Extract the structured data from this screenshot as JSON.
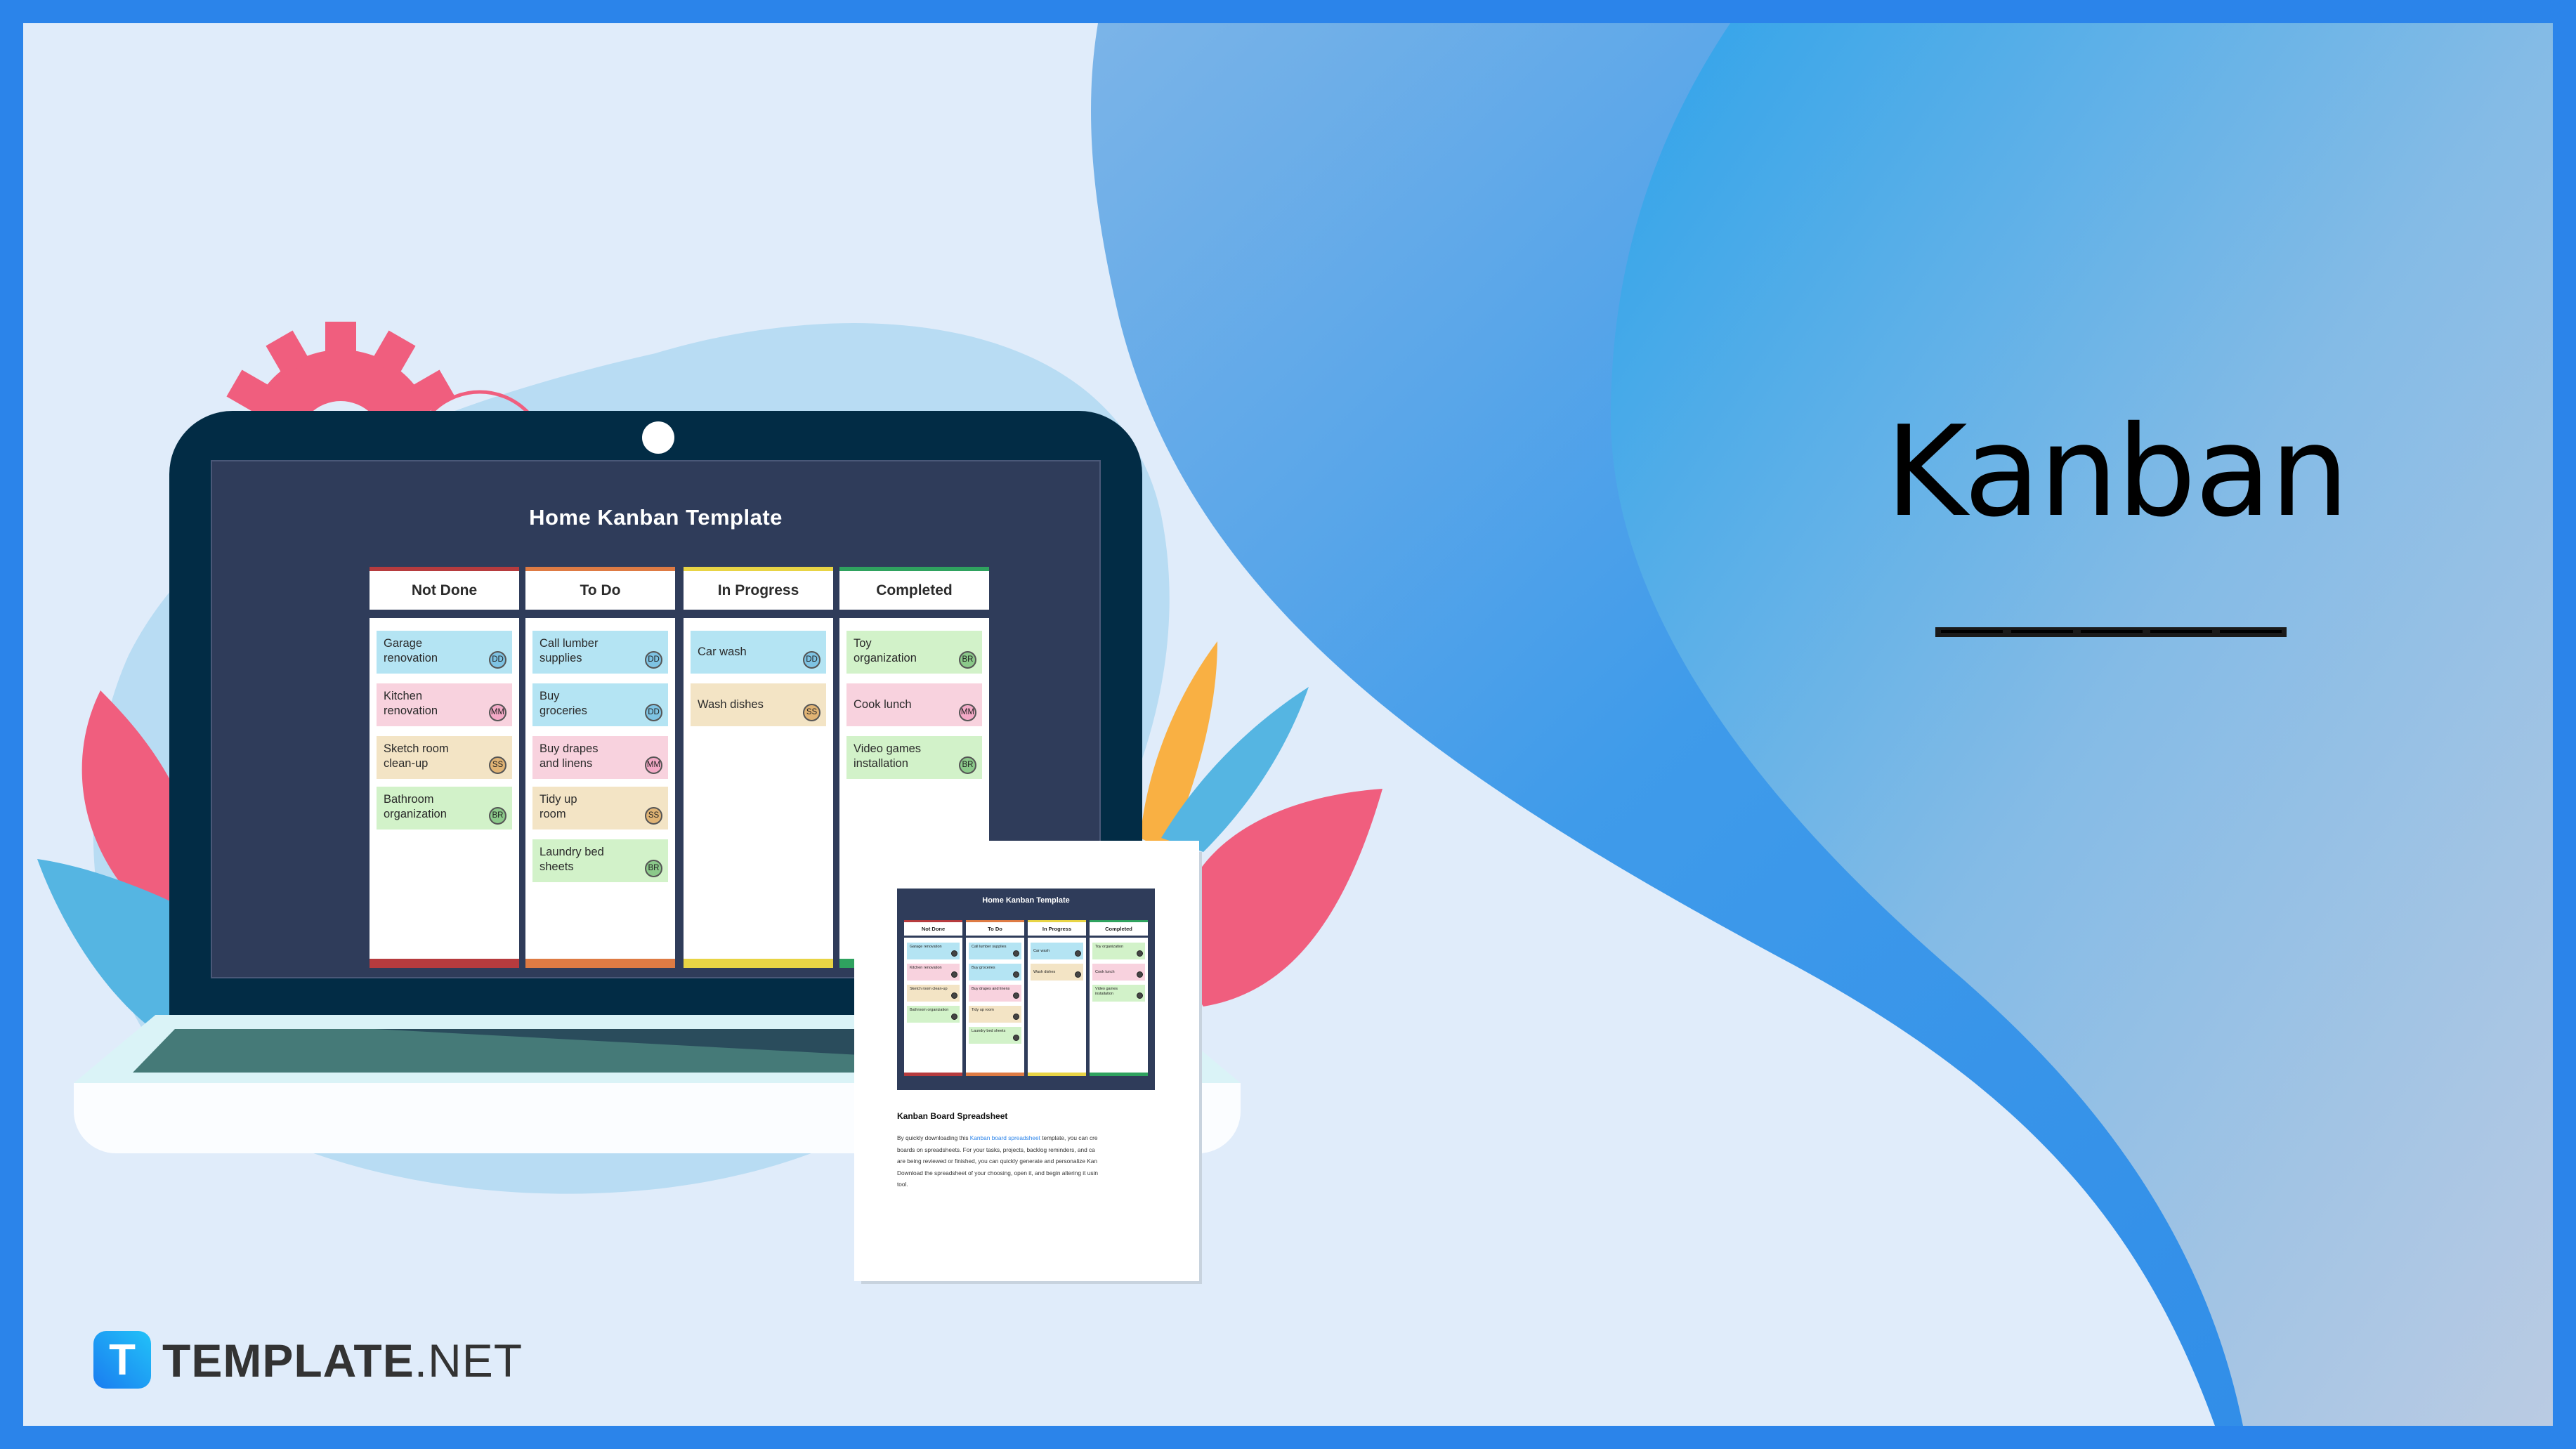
{
  "hero": {
    "title": "Kanban"
  },
  "brand": {
    "icon_letter": "T",
    "name_bold": "TEMPLATE",
    "name_light": ".NET"
  },
  "colors": {
    "frame": "#2B84EA",
    "background": "#E0ECFA",
    "laptop_bezel": "#022C45",
    "screen": "#2F3C5A",
    "not_done": "#B63B3E",
    "to_do": "#DE7B44",
    "in_progress": "#E8D445",
    "completed": "#2FA25F",
    "card_blue": "#B4E4F3",
    "card_pink": "#F8D2DE",
    "card_tan": "#F3E4C5",
    "card_green": "#D2F2C9"
  },
  "board": {
    "title": "Home Kanban Template",
    "columns": [
      {
        "label": "Not Done",
        "cards": [
          {
            "text": "Garage renovation",
            "line1": "Garage",
            "line2": "renovation",
            "assignee": "DD",
            "color": "blue"
          },
          {
            "text": "Kitchen renovation",
            "line1": "Kitchen",
            "line2": "renovation",
            "assignee": "MM",
            "color": "pink"
          },
          {
            "text": "Sketch room clean-up",
            "line1": "Sketch room",
            "line2": "clean-up",
            "assignee": "SS",
            "color": "tan"
          },
          {
            "text": "Bathroom organization",
            "line1": "Bathroom",
            "line2": "organization",
            "assignee": "BR",
            "color": "green"
          }
        ]
      },
      {
        "label": "To Do",
        "cards": [
          {
            "text": "Call lumber supplies",
            "line1": "Call lumber",
            "line2": "supplies",
            "assignee": "DD",
            "color": "blue"
          },
          {
            "text": "Buy groceries",
            "line1": "Buy",
            "line2": "groceries",
            "assignee": "DD",
            "color": "blue"
          },
          {
            "text": "Buy drapes and linens",
            "line1": "Buy drapes",
            "line2": "and linens",
            "assignee": "MM",
            "color": "pink"
          },
          {
            "text": "Tidy up room",
            "line1": "Tidy up",
            "line2": "room",
            "assignee": "SS",
            "color": "tan"
          },
          {
            "text": "Laundry bed sheets",
            "line1": "Laundry bed",
            "line2": "sheets",
            "assignee": "BR",
            "color": "green"
          }
        ]
      },
      {
        "label": "In Progress",
        "cards": [
          {
            "text": "Car wash",
            "line1": "Car wash",
            "line2": "",
            "assignee": "DD",
            "color": "blue"
          },
          {
            "text": "Wash dishes",
            "line1": "Wash dishes",
            "line2": "",
            "assignee": "SS",
            "color": "tan"
          }
        ]
      },
      {
        "label": "Completed",
        "cards": [
          {
            "text": "Toy organization",
            "line1": "Toy",
            "line2": "organization",
            "assignee": "BR",
            "color": "green"
          },
          {
            "text": "Cook lunch",
            "line1": "Cook lunch",
            "line2": "",
            "assignee": "MM",
            "color": "pink"
          },
          {
            "text": "Video games installation",
            "line1": "Video games",
            "line2": "installation",
            "assignee": "BR",
            "color": "green"
          }
        ]
      }
    ]
  },
  "document": {
    "heading": "Kanban Board Spreadsheet",
    "para_prefix": "By quickly downloading this ",
    "para_link": "Kanban board spreadsheet",
    "para_line1_suffix": " template, you can cre",
    "para_line2": "boards on spreadsheets. For your tasks, projects, backlog reminders, and ca",
    "para_line3": "are being reviewed or finished, you can quickly generate and personalize Kan",
    "para_line4": "Download the spreadsheet of your choosing, open it, and begin altering it usin",
    "para_line5": "tool."
  }
}
